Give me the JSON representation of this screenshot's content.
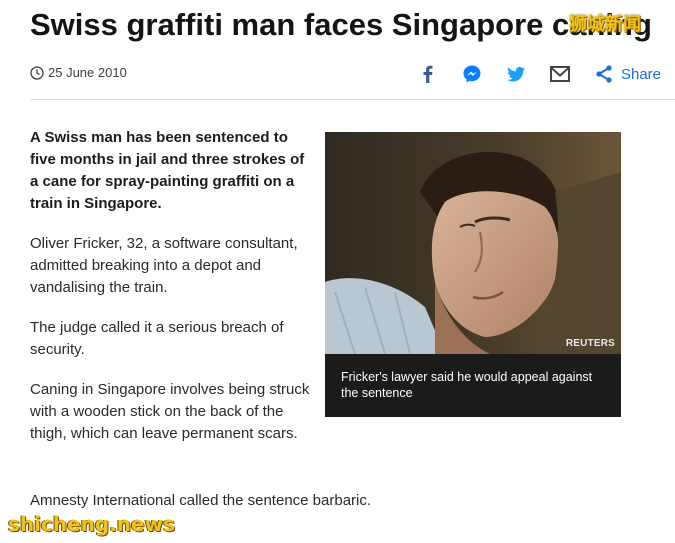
{
  "article": {
    "headline": "Swiss graffiti man faces Singapore caning",
    "date": "25 June 2010",
    "lead": "A Swiss man has been sentenced to five months in jail and three strokes of a cane for spray-painting graffiti on a train in Singapore.",
    "paragraphs": [
      "Oliver Fricker, 32, a software consultant, admitted breaking into a depot and vandalising the train.",
      "The judge called it a serious breach of security.",
      "Caning in Singapore involves being struck with a wooden stick on the back of the thigh, which can leave permanent scars."
    ],
    "last_paragraph": "Amnesty International called the sentence barbaric."
  },
  "share": {
    "label": "Share",
    "icons": [
      "facebook-icon",
      "messenger-icon",
      "twitter-icon",
      "email-icon",
      "share-icon"
    ],
    "colors": {
      "facebook": "#3b5998",
      "messenger": "#0a7cff",
      "twitter": "#1da1f2",
      "email": "#444444",
      "share": "#1a6fcf"
    }
  },
  "figure": {
    "credit": "REUTERS",
    "caption": "Fricker's lawyer said he would appeal against the sentence"
  },
  "watermarks": {
    "top": "狮城新闻",
    "bottom": "shicheng.news"
  },
  "colors": {
    "text": "#141414",
    "link": "#1a6fcf",
    "watermark": "#f3c316"
  }
}
